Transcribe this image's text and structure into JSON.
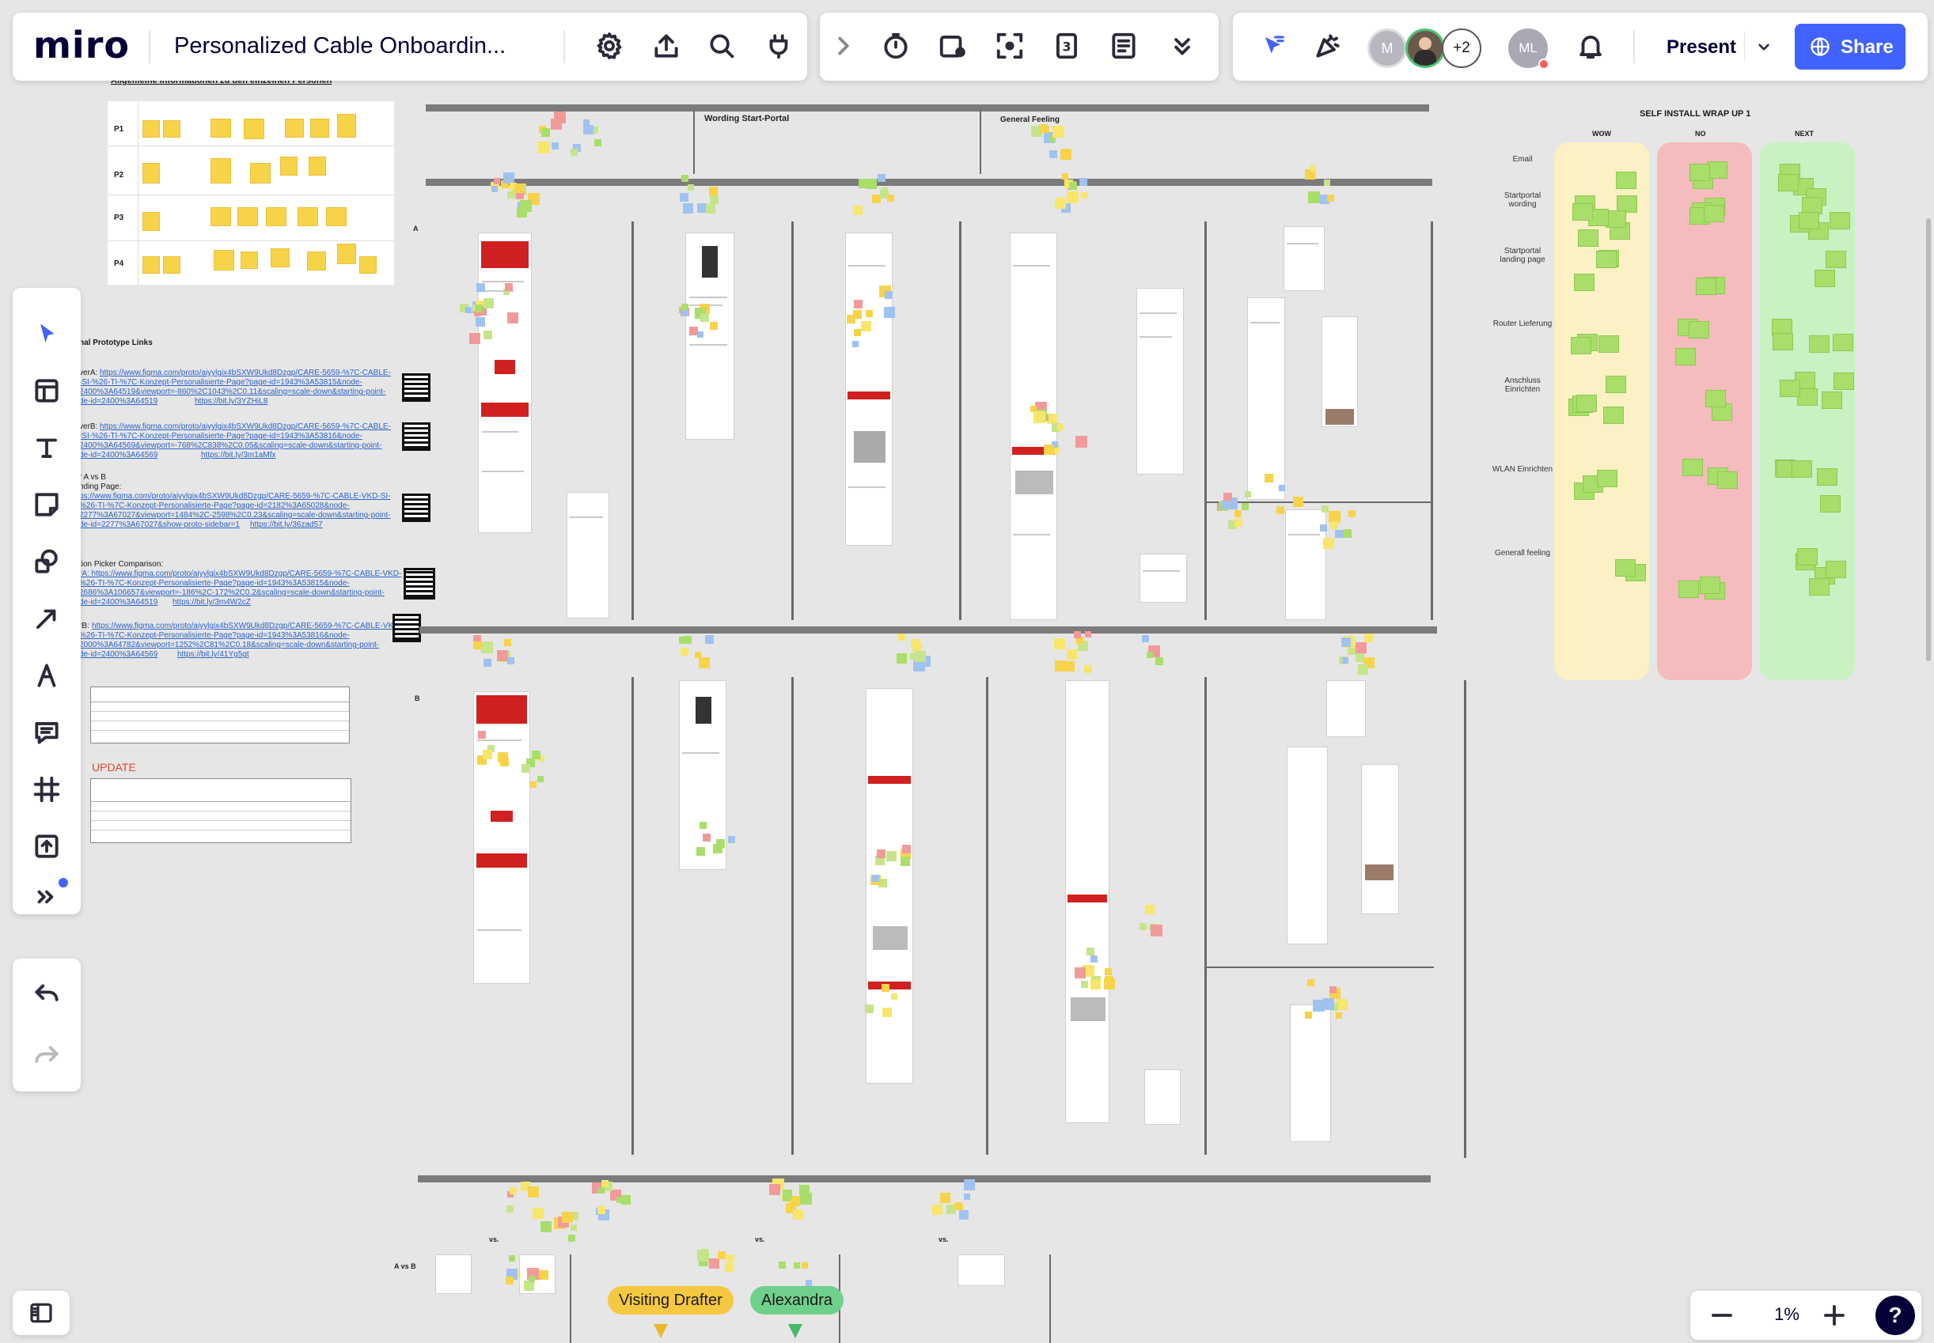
{
  "app": {
    "logo": "miro",
    "board_title": "Personalized Cable Onboardin...",
    "present_label": "Present",
    "share_label": "Share",
    "zoom_level": "1%",
    "help_label": "?",
    "collaborators": {
      "avatar_1_initial": "M",
      "more_count": "+2",
      "current_user_initials": "ML"
    },
    "accent_color": "#4262ff"
  },
  "top_toolbar": {
    "icons": [
      "settings-icon",
      "export-icon",
      "search-icon",
      "plugin-icon"
    ],
    "collapse_chevron": "chevron-right-icon",
    "tools": [
      "timer-icon",
      "card-icon",
      "focus-icon",
      "voting-icon",
      "notes-icon",
      "more-down-icon"
    ]
  },
  "left_toolbar": {
    "tools": [
      "select-icon",
      "templates-icon",
      "text-icon",
      "sticky-note-icon",
      "shapes-icon",
      "connector-icon",
      "pen-icon",
      "comment-icon",
      "frame-icon",
      "upload-icon",
      "more-tools-icon"
    ],
    "undo": "undo-icon",
    "redo": "redo-icon"
  },
  "board": {
    "section_titles": {
      "persons_header": "Allgemeine Informationen zu den einzelnen Personen",
      "wording_start_portal": "Wording Start-Portal",
      "general_feeling": "General Feeling",
      "prototype_links": "nal Prototype Links",
      "self_install_title": "SELF INSTALL WRAP UP 1",
      "update_label": "UPDATE",
      "a_vs_b": "A vs B",
      "row_a": "A",
      "row_b": "B",
      "vs": "vs."
    },
    "person_rows": [
      "P1",
      "P2",
      "P3",
      "P4"
    ],
    "links": [
      {
        "label": "verA:",
        "url": "https://www.figma.com/proto/aiyylgix4bSXW9Ukd8Dzgp/CARE-5659-%7C-CABLE-",
        "url2": "-SI-%26-TI-%7C-Konzept-Personalisierte-Page?page-id=1943%3A53815&node-",
        "url3": "2400%3A64519&viewport=-860%2C1043%2C0.11&scaling=scale-down&starting-point-",
        "url4": "de-id=2400%3A64519",
        "short": "https://bit.ly/3YZHiL8"
      },
      {
        "label": "verB:",
        "url": "https://www.figma.com/proto/aiyylgix4bSXW9Ukd8Dzgp/CARE-5659-%7C-CABLE-",
        "url2": "-SI-%26-TI-%7C-Konzept-Personalisierte-Page?page-id=1943%3A53816&node-",
        "url3": "2400%3A64569&viewport=-768%2C838%2C0.05&scaling=scale-down&starting-point-",
        "url4": "de-id=2400%3A64569",
        "short": "https://bit.ly/3m1aMfx"
      },
      {
        "label": "r A vs B",
        "url": "nding Page:",
        "url2": "ps://www.figma.com/proto/aiyylgix4bSXW9Ukd8Dzgp/CARE-5659-%7C-CABLE-VKD-SI-",
        "url3": "%26-TI-%7C-Konzept-Personalisierte-Page?page-id=2182%3A65028&node-",
        "url4": "2277%3A67027&viewport=1484%2C-2598%2C0.23&scaling=scale-down&starting-point-",
        "url5": "de-id=2277%3A67027&show-proto-sidebar=1",
        "short": "https://bit.ly/36zad57"
      },
      {
        "label": "tion Picker Comparison:",
        "url": "rA: https://www.figma.com/proto/aiyylgix4bSXW9Ukd8Dzgp/CARE-5659-%7C-CABLE-VKD-",
        "url2": "%26-TI-%7C-Konzept-Personalisierte-Page?page-id=1943%3A53815&node-",
        "url3": "2686%3A106657&viewport=-186%2C-172%2C0.2&scaling=scale-down&starting-point-",
        "url4": "de-id=2400%3A64519",
        "short": "https://bit.ly/3m4W2cZ"
      },
      {
        "label": "rB:",
        "url": "https://www.figma.com/proto/aiyylgix4bSXW9Ukd8Dzgp/CARE-5659-%7C-CABLE-VKD-",
        "url2": "%26-TI-%7C-Konzept-Personalisierte-Page?page-id=1943%3A53816&node-",
        "url3": "2000%3A64782&viewport=1252%2C81%2C0.18&scaling=scale-down&starting-point-",
        "url4": "de-id=2400%3A64569",
        "short": "https://bit.ly/41Yg5gt"
      }
    ],
    "wrap_up": {
      "columns": [
        "WOW",
        "NO",
        "NEXT"
      ],
      "rows": [
        "Email",
        "Startportal wording",
        "Startportal landing page",
        "Router Lieferung",
        "Anschluss Einrichten",
        "WLAN Einrichten",
        "Generall feeling"
      ]
    },
    "cursor_tags": [
      {
        "name": "Visiting Drafter",
        "color": "#f5c842"
      },
      {
        "name": "Alexandra",
        "color": "#6fd08c"
      }
    ]
  }
}
